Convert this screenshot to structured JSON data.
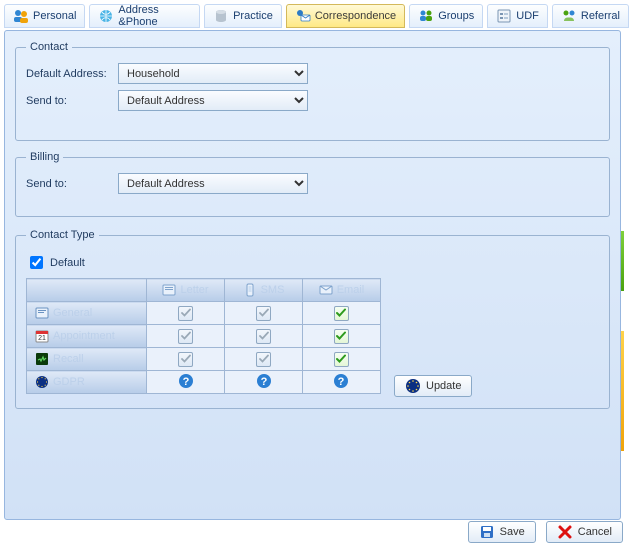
{
  "tabs": [
    {
      "label": "Personal"
    },
    {
      "label": "Address &Phone"
    },
    {
      "label": "Practice"
    },
    {
      "label": "Correspondence"
    },
    {
      "label": "Groups"
    },
    {
      "label": "UDF"
    },
    {
      "label": "Referral"
    }
  ],
  "active_tab_index": 3,
  "contact": {
    "legend": "Contact",
    "default_address_label": "Default Address:",
    "default_address_value": "Household",
    "send_to_label": "Send to:",
    "send_to_value": "Default Address"
  },
  "billing": {
    "legend": "Billing",
    "send_to_label": "Send to:",
    "send_to_value": "Default Address"
  },
  "contact_type": {
    "legend": "Contact Type",
    "default_label": "Default",
    "default_checked": true,
    "columns": [
      "Letter",
      "SMS",
      "Email"
    ],
    "rows": [
      {
        "label": "General",
        "cells": [
          "grey",
          "grey",
          "green"
        ]
      },
      {
        "label": "Appointment",
        "cells": [
          "grey",
          "grey",
          "green"
        ]
      },
      {
        "label": "Recall",
        "cells": [
          "grey",
          "grey",
          "green"
        ]
      },
      {
        "label": "GDPR",
        "cells": [
          "help",
          "help",
          "help"
        ]
      }
    ],
    "update_label": "Update"
  },
  "footer": {
    "save_label": "Save",
    "cancel_label": "Cancel"
  }
}
